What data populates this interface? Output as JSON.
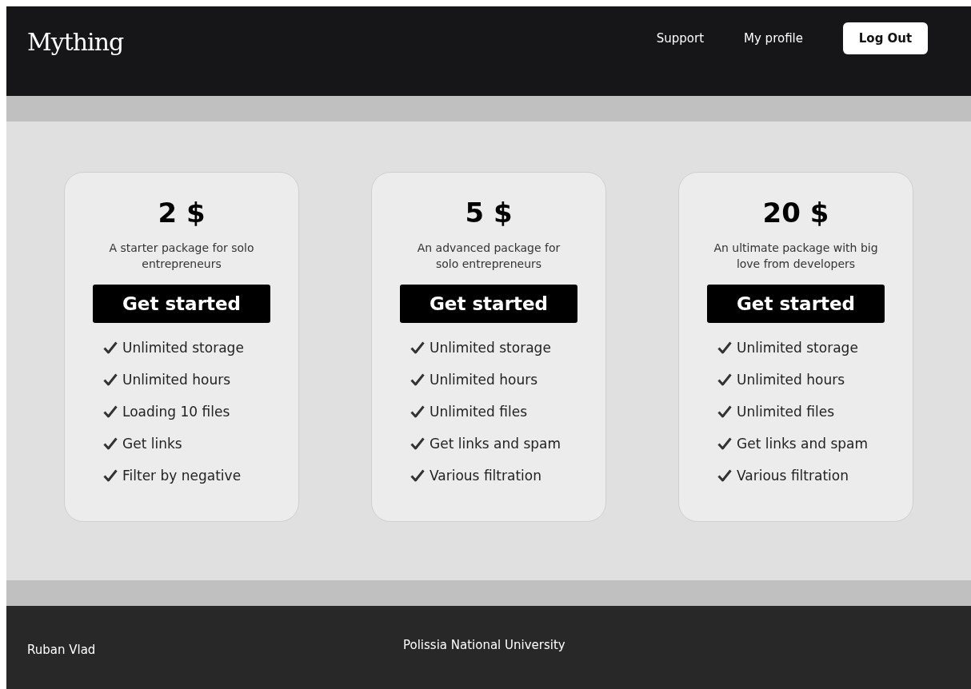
{
  "header": {
    "logo": "Mything",
    "nav": [
      "Support",
      "My profile"
    ],
    "logout": "Log Out"
  },
  "plans": [
    {
      "price": "2 $",
      "description": "A starter package for solo entrepreneurs",
      "button": "Get started",
      "features": [
        "Unlimited storage",
        "Unlimited hours",
        "Loading 10 files",
        "Get links",
        "Filter by negative"
      ]
    },
    {
      "price": "5 $",
      "description": "An advanced package for solo entrepreneurs",
      "button": "Get started",
      "features": [
        "Unlimited storage",
        "Unlimited hours",
        "Unlimited files",
        "Get links and spam",
        "Various filtration"
      ]
    },
    {
      "price": "20 $",
      "description": "An ultimate package with big love from developers",
      "button": "Get started",
      "features": [
        "Unlimited storage",
        "Unlimited hours",
        "Unlimited files",
        "Get links and spam",
        "Various filtration"
      ]
    }
  ],
  "footer": {
    "author": "Ruban Vlad",
    "university": "Polissia National University"
  }
}
